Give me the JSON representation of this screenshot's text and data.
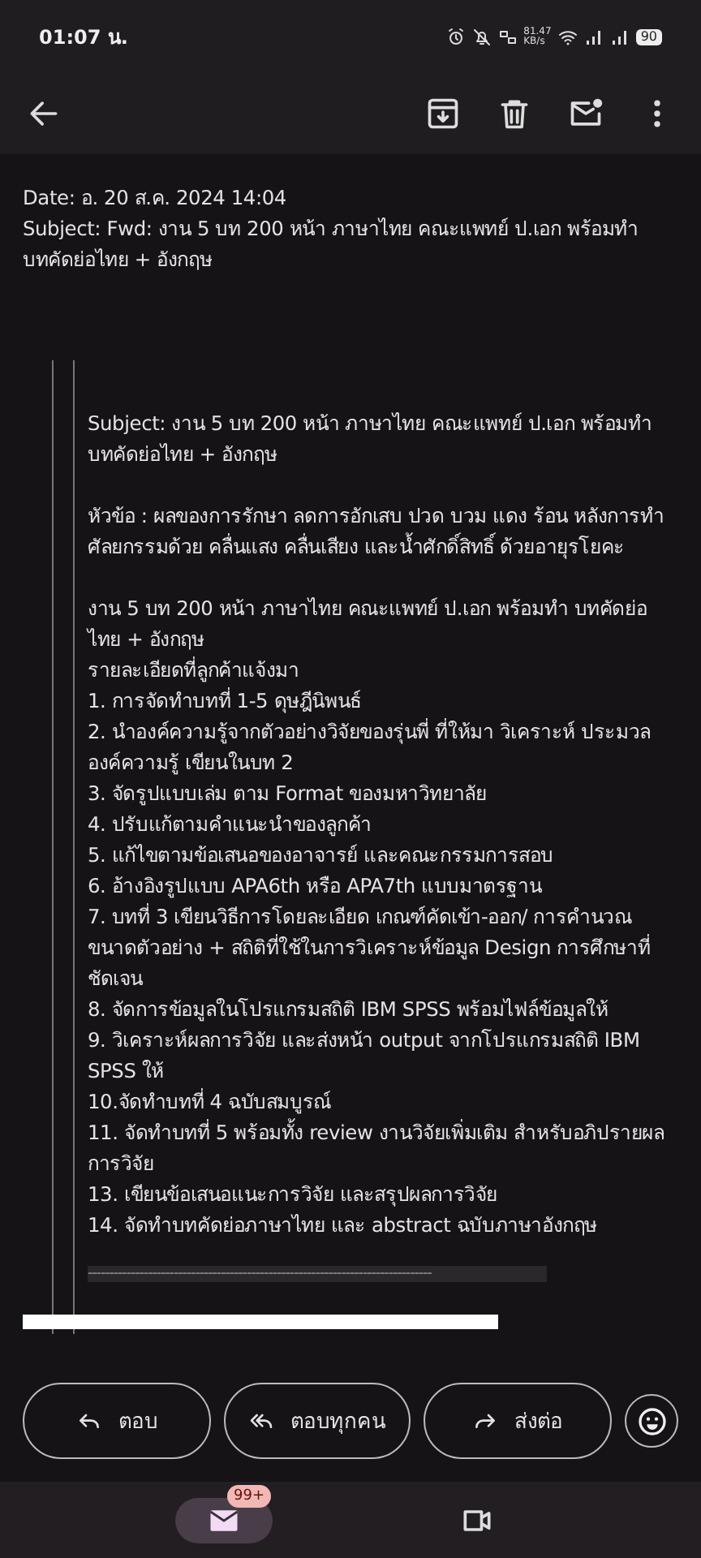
{
  "status_bar": {
    "time": "01:07 น.",
    "speed": "81.47",
    "speed_unit": "KB/s",
    "battery": "90"
  },
  "toolbar": {
    "actions": [
      {
        "kind": "archive"
      },
      {
        "kind": "delete"
      },
      {
        "kind": "unread"
      },
      {
        "kind": "more"
      }
    ]
  },
  "header_lines": [
    "Date: อ. 20 ส.ค. 2024 14:04",
    "Subject: Fwd: งาน 5 บท 200 หน้า ภาษาไทย คณะแพทย์ ป.เอก พร้อมทำ บทคัดย่อไทย + อังกฤษ"
  ],
  "quoted_blocks": [
    [
      "Subject: งาน 5 บท 200 หน้า ภาษาไทย คณะแพทย์ ป.เอก พร้อมทำ บทคัดย่อไทย + อังกฤษ"
    ],
    [
      "หัวข้อ :  ผลของการรักษา ลดการอักเสบ  ปวด บวม แดง ร้อน หลังการทำศัลยกรรมด้วย คลื่นแสง คลื่นเสียง และน้ำศักดิ์สิทธิ์  ด้วยอายุรโยคะ"
    ],
    [
      "งาน 5 บท 200 หน้า ภาษาไทย คณะแพทย์ ป.เอก พร้อมทำ บทคัดย่อไทย + อังกฤษ",
      "รายละเอียดที่ลูกค้าแจ้งมา",
      "1. การจัดทำบทที่ 1-5 ดุษฎีนิพนธ์",
      "2. นำองค์ความรู้จากตัวอย่างวิจัยของรุ่นพี่ ที่ให้มา วิเคราะห์ ประมวลองค์ความรู้ เขียนในบท 2",
      "3. จัดรูปแบบเล่ม ตาม Format ของมหาวิทยาลัย",
      "4.  ปรับแก้ตามคำแนะนำของลูกค้า",
      "5.  แก้ไขตามข้อเสนอของอาจารย์ และคณะกรรมการสอบ",
      "6. อ้างอิงรูปแบบ APA6th หรือ APA7th แบบมาตรฐาน",
      "7. บทที่ 3 เขียนวิธีการโดยละเอียด เกณฑ์คัดเข้า-ออก/ การคำนวณขนาดตัวอย่าง + สถิติที่ใช้ในการวิเคราะห์ข้อมูล Design การศึกษาที่ชัดเจน",
      "8. จัดการข้อมูลในโปรแกรมสถิติ IBM SPSS พร้อมไฟล์ข้อมูลให้",
      "9. วิเคราะห์ผลการวิจัย และส่งหน้า output จากโปรแกรมสถิติ IBM SPSS ให้",
      "10.จัดทำบทที่ 4 ฉบับสมบูรณ์",
      "11. จัดทำบทที่ 5 พร้อมทั้ง review งานวิจัยเพิ่มเติม สำหรับอภิปรายผลการวิจัย",
      "13. เขียนข้อเสนอแนะการวิจัย และสรุปผลการวิจัย",
      "14. จัดทำบทคัดย่อภาษาไทย และ abstract ฉบับภาษาอังกฤษ"
    ]
  ],
  "divider_text": "--------------------------------------------------------------------------------",
  "reply_actions": [
    {
      "kind": "reply",
      "label": "ตอบ"
    },
    {
      "kind": "reply_all",
      "label": "ตอบทุกคน"
    },
    {
      "kind": "forward",
      "label": "ส่งต่อ"
    }
  ],
  "bottom_nav": [
    {
      "kind": "mail",
      "selected": true,
      "badge": "99+"
    },
    {
      "kind": "video",
      "selected": false
    }
  ]
}
